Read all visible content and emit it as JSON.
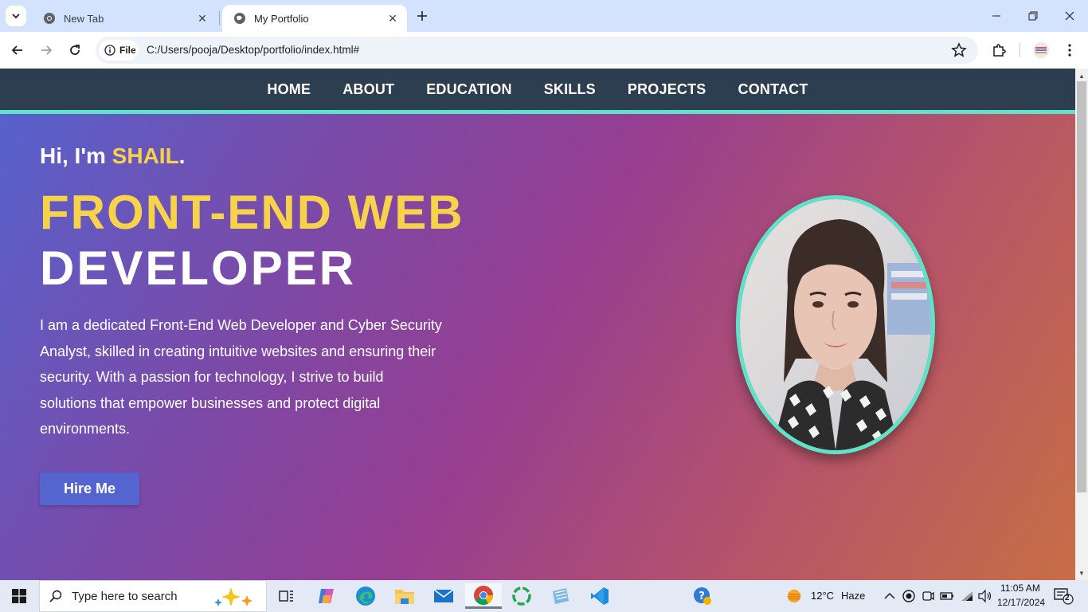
{
  "browser": {
    "tabs": [
      {
        "title": "New Tab",
        "active": false
      },
      {
        "title": "My Portfolio",
        "active": true
      }
    ],
    "site_chip_label": "File",
    "url": "C:/Users/pooja/Desktop/portfolio/index.html#"
  },
  "site": {
    "nav": [
      "HOME",
      "ABOUT",
      "EDUCATION",
      "SKILLS",
      "PROJECTS",
      "CONTACT"
    ],
    "greeting_prefix": "Hi, I'm ",
    "greeting_name": "SHAIL",
    "greeting_suffix": ".",
    "headline_line1": "FRONT-END WEB",
    "headline_line2": "DEVELOPER",
    "bio": "I am a dedicated Front-End Web Developer and Cyber Security Analyst, skilled in creating intuitive websites and ensuring their security. With a passion for technology, I strive to build solutions that empower businesses and protect digital environments.",
    "hire_button": "Hire Me",
    "colors": {
      "nav_bg": "#2c3e50",
      "accent_teal": "#5fe3c8",
      "accent_yellow": "#f7d34b",
      "button_bg": "#5465cf"
    }
  },
  "taskbar": {
    "search_placeholder": "Type here to search",
    "weather_temp": "12°C",
    "weather_desc": "Haze",
    "time": "11:05 AM",
    "date": "12/17/2024",
    "notification_count": "2"
  }
}
